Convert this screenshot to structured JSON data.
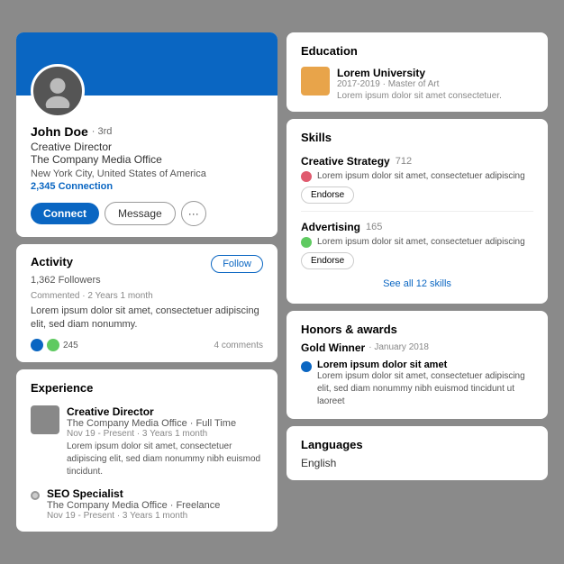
{
  "profile": {
    "name": "John Doe",
    "badge": "· 3rd",
    "title": "Creative Director",
    "company": "The Company Media Office",
    "location": "New York City, United States of America",
    "connections": "2,345 Connection",
    "actions": {
      "connect": "Connect",
      "message": "Message",
      "more": "···"
    }
  },
  "activity": {
    "title": "Activity",
    "follow_label": "Follow",
    "followers": "1,362 Followers",
    "meta": "Commented · 2 Years 1 month",
    "text": "Lorem ipsum dolor sit amet, consectetuer adipiscing elit, sed diam nonummy.",
    "likes": "245",
    "comments": "4 comments"
  },
  "experience": {
    "title": "Experience",
    "items": [
      {
        "title": "Creative Director",
        "company": "The Company Media Office · Full Time",
        "date": "Nov 19 - Present · 3 Years 1 month",
        "desc": "Lorem ipsum dolor sit amet, consectetuer adipiscing elit, sed diam nonummy nibh euismod tincidunt."
      },
      {
        "title": "SEO Specialist",
        "company": "The Company Media Office · Freelance",
        "date": "Nov 19 - Present · 3 Years 1 month",
        "desc": ""
      }
    ]
  },
  "education": {
    "title": "Education",
    "school": "Lorem University",
    "degree": "Master of Art",
    "date": "2017-2019 · Master of Art",
    "desc": "Lorem ipsum dolor sit amet consectetuer."
  },
  "skills": {
    "title": "Skills",
    "items": [
      {
        "name": "Creative Strategy",
        "count": "712",
        "desc": "Lorem ipsum dolor sit amet, consectetuer adipiscing",
        "endorse": "Endorse"
      },
      {
        "name": "Advertising",
        "count": "165",
        "desc": "Lorem ipsum dolor sit amet, consectetuer adipiscing",
        "endorse": "Endorse"
      }
    ],
    "see_all": "See all 12 skills"
  },
  "honors": {
    "title": "Honors & awards",
    "award": "Gold Winner",
    "date": "· January 2018",
    "short": "Lorem ipsum dolor sit amet",
    "desc": "Lorem ipsum dolor sit amet, consectetuer adipiscing elit, sed diam nonummy nibh euismod tincidunt ut laoreet"
  },
  "languages": {
    "title": "Languages",
    "items": [
      "English"
    ]
  }
}
